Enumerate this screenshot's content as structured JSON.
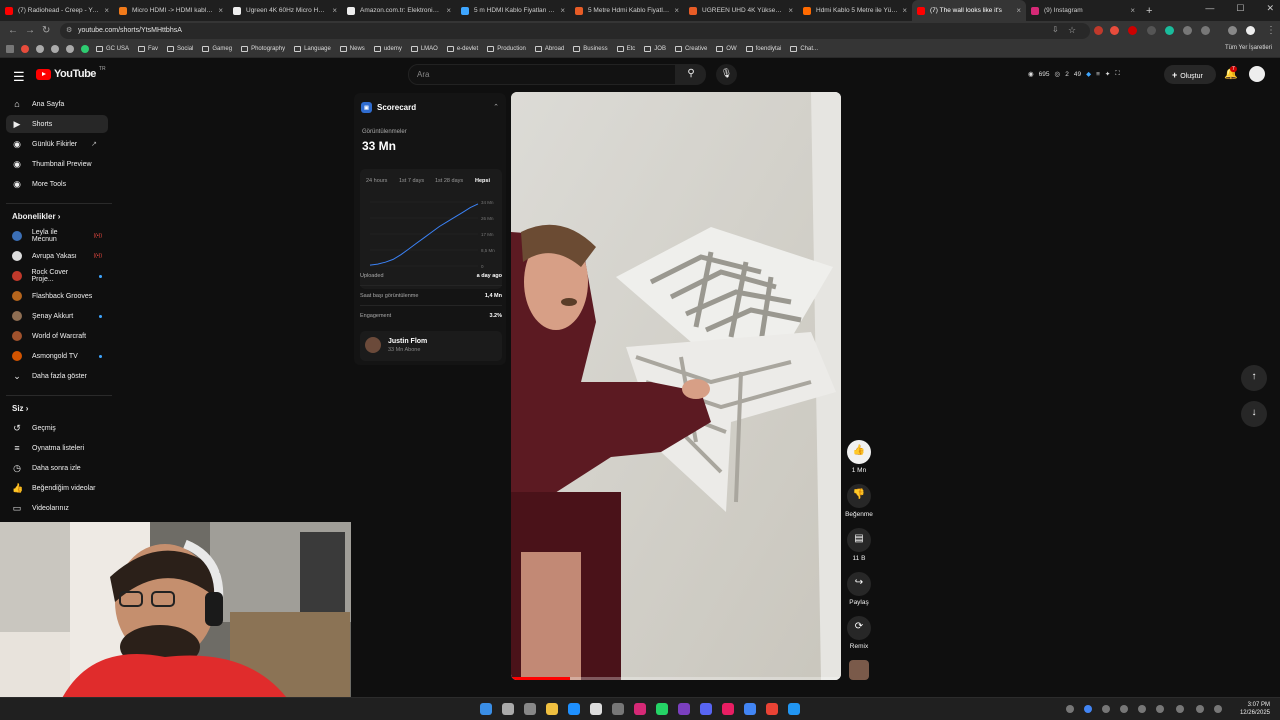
{
  "browser": {
    "tabs": [
      {
        "title": "(7) Radiohead - Creep - YouTube",
        "color": "#ff0000",
        "active": false
      },
      {
        "title": "Micro HDMI -> HDMI kablo - Trendyol",
        "color": "#f27a1a",
        "active": false
      },
      {
        "title": "Ugreen 4K 60Hz Micro HDMI",
        "color": "#eeeeee",
        "active": false
      },
      {
        "title": "Amazon.com.tr: Elektronik, bilgisayar",
        "color": "#eeeeee",
        "active": false
      },
      {
        "title": "5 m HDMI Kablo Fiyatları | Epey",
        "color": "#3ea6ff",
        "active": false
      },
      {
        "title": "5 Metre Hdmi Kablo Fiyatları",
        "color": "#e85c26",
        "active": false
      },
      {
        "title": "UGREEN UHD 4K Yüksek Hızlı",
        "color": "#e85c26",
        "active": false
      },
      {
        "title": "Hdmi Kablo 5 Metre ile Yüksek",
        "color": "#ff6a00",
        "active": false
      },
      {
        "title": "(7) The wall looks like it's",
        "color": "#ff0000",
        "active": true
      },
      {
        "title": "(9) Instagram",
        "color": "#d62976",
        "active": false
      }
    ],
    "new_tab": "+",
    "url": "youtube.com/shorts/YtsMHttbhsA",
    "bookmarks": [
      "GC USA",
      "Fav",
      "Social",
      "Gameg",
      "Photography",
      "Language",
      "News",
      "udemy",
      "LMAO",
      "e-devlet",
      "Production",
      "Abroad",
      "Business",
      "Etc",
      "JOB",
      "Creative",
      "OW",
      "foendiytai",
      "Chat..."
    ],
    "bookmarks_right": "Tüm Yer İşaretleri"
  },
  "youtube": {
    "logo_text": "YouTube",
    "region": "TR",
    "search_placeholder": "Ara",
    "stats": {
      "views": "695",
      "likes": "2",
      "extra": "49"
    },
    "create_label": "Oluştur",
    "notification_count": "7"
  },
  "sidebar": {
    "main": [
      {
        "label": "Ana Sayfa",
        "icon": "home-icon"
      },
      {
        "label": "Shorts",
        "icon": "shorts-icon",
        "active": true
      },
      {
        "label": "Günlük Fikirler",
        "icon": "ext-icon"
      },
      {
        "label": "Thumbnail Preview",
        "icon": "ext-icon"
      },
      {
        "label": "More Tools",
        "icon": "ext-icon"
      }
    ],
    "subs_title": "Abonelikler",
    "subscriptions": [
      {
        "label": "Leyla ile Mecnun",
        "color": "#3b6fb6",
        "badge": "live"
      },
      {
        "label": "Avrupa Yakası",
        "color": "#dddddd",
        "badge": "live"
      },
      {
        "label": "Rock Cover Proje...",
        "color": "#c0392b",
        "badge": "dot"
      },
      {
        "label": "Flashback Grooves",
        "color": "#b5651d",
        "badge": ""
      },
      {
        "label": "Şenay Akkurt",
        "color": "#8e6e53",
        "badge": "dot"
      },
      {
        "label": "World of Warcraft",
        "color": "#a0522d",
        "badge": ""
      },
      {
        "label": "Asmongold TV",
        "color": "#d35400",
        "badge": "dot"
      }
    ],
    "show_more": "Daha fazla göster",
    "you_title": "Siz",
    "you": [
      {
        "label": "Geçmiş"
      },
      {
        "label": "Oynatma listeleri"
      },
      {
        "label": "Daha sonra izle"
      },
      {
        "label": "Beğendiğim videolar"
      },
      {
        "label": "Videolarınız"
      }
    ]
  },
  "scorecard": {
    "title": "Scorecard",
    "views_label": "Görüntülenmeler",
    "views_value": "33 Mn",
    "ranges": [
      "24 hours",
      "1st 7 days",
      "1st 28 days",
      "Hepsi"
    ],
    "selected_range": "Hepsi",
    "chart_data": {
      "type": "line",
      "y_ticks": [
        "34 Mn",
        "26 Mn",
        "17 Mn",
        "8,5 Mn",
        "0"
      ],
      "values": [
        0.5,
        1,
        2,
        3.5,
        6,
        9,
        12,
        15,
        18,
        21,
        23.5,
        26,
        28.5,
        31,
        33
      ],
      "ylim": [
        0,
        34
      ]
    },
    "rows": [
      {
        "label": "Uploaded",
        "value": "a day ago"
      },
      {
        "label": "Saat başı görüntülenme",
        "value": "1,4 Mn"
      },
      {
        "label": "Engagement",
        "value": "3.2%"
      }
    ],
    "creator": {
      "name": "Justin Flom",
      "subs": "33 Mn Abone"
    }
  },
  "short": {
    "progress": 0.18,
    "actions": {
      "like_count": "1 Mn",
      "dislike_label": "Beğenme",
      "comment_count": "11 B",
      "share_label": "Paylaş",
      "remix_label": "Remix"
    }
  },
  "taskbar": {
    "time": "3:07 PM",
    "date": "12/26/2025"
  }
}
